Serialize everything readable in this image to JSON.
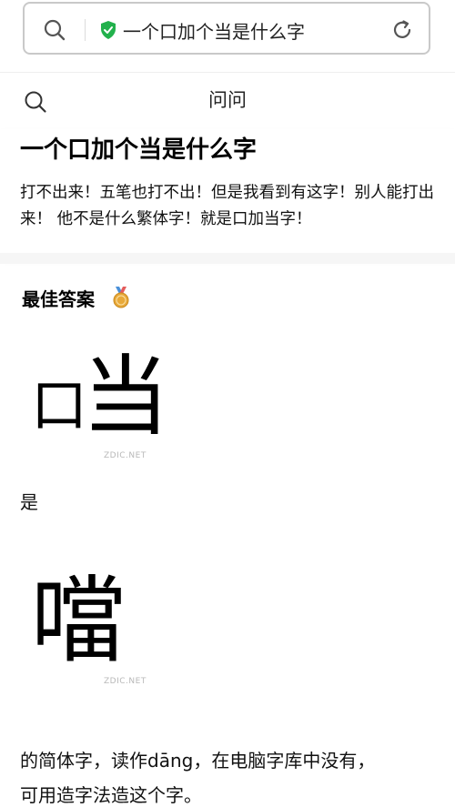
{
  "browser": {
    "url_text": "一个口加个当是什么字"
  },
  "header": {
    "title": "问问"
  },
  "question": {
    "title": "一个口加个当是什么字",
    "detail": "打不出来！五笔也打不出！但是我看到有这字！别人能打出来！ 他不是什么繁体字！就是口加当字！"
  },
  "answer": {
    "label": "最佳答案",
    "image1": {
      "glyph": "口当",
      "watermark": "ZDIC.NET"
    },
    "text1": "是",
    "image2": {
      "glyph": "噹",
      "watermark": "ZDIC.NET"
    },
    "text2": "的简体字，读作dāng，在电脑字库中没有，",
    "text3": "可用造字法造这个字。"
  },
  "colors": {
    "shield": "#22b14c",
    "medal": "#e0a030",
    "medal_ribbon": "#4a90d9"
  }
}
